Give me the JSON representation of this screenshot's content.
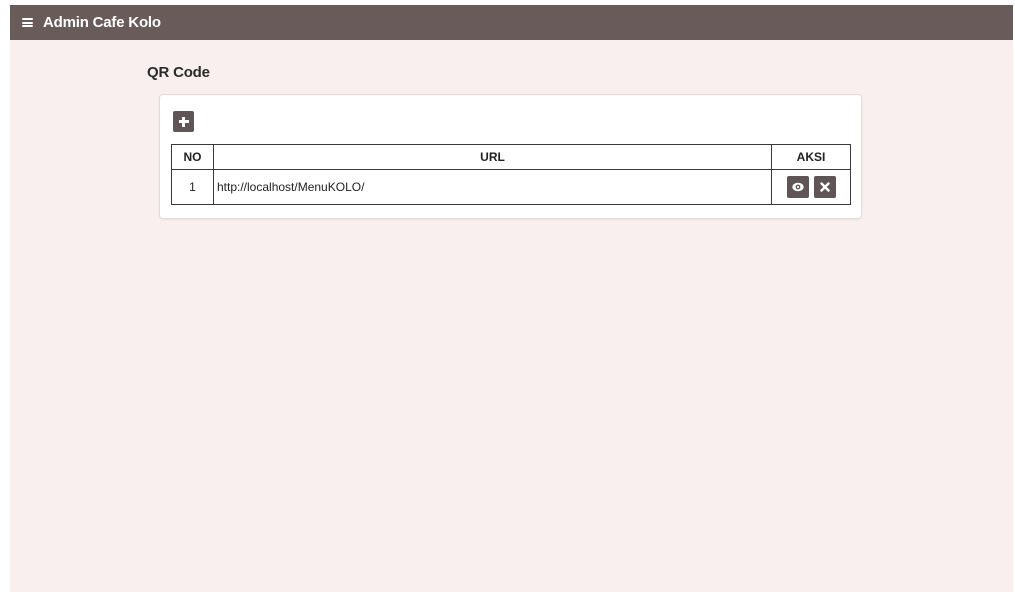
{
  "header": {
    "menu_icon": "hamburger-icon",
    "title": "Admin Cafe Kolo"
  },
  "page": {
    "title": "QR Code"
  },
  "toolbar": {
    "add_icon": "plus-icon"
  },
  "table": {
    "columns": [
      "NO",
      "URL",
      "AKSI"
    ],
    "rows": [
      {
        "no": "1",
        "url": "http://localhost/MenuKOLO/",
        "actions": [
          "eye-icon",
          "close-icon"
        ]
      }
    ]
  },
  "colors": {
    "topbar": "#6a5b5b",
    "background": "#f8efee",
    "button": "#5f5556"
  }
}
